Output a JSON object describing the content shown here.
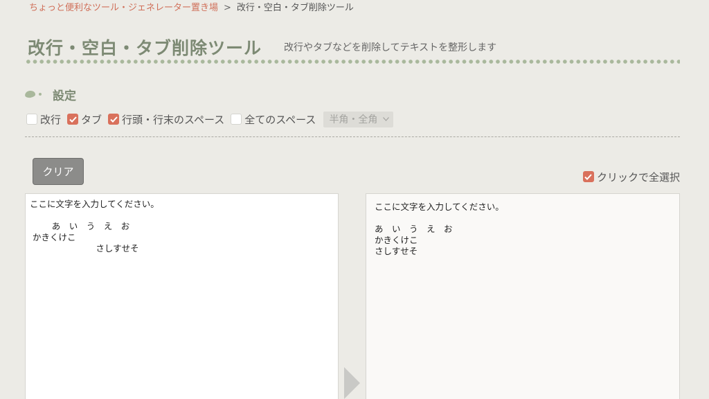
{
  "breadcrumb": {
    "home": "ちょっと便利なツール・ジェネレーター置き場",
    "separator": ">",
    "current": "改行・空白・タブ削除ツール"
  },
  "page": {
    "title": "改行・空白・タブ削除ツール",
    "subtitle": "改行やタブなどを削除してテキストを整形します"
  },
  "settings": {
    "heading": "設定",
    "options": [
      {
        "label": "改行",
        "checked": false
      },
      {
        "label": "タブ",
        "checked": true
      },
      {
        "label": "行頭・行末のスペース",
        "checked": true
      },
      {
        "label": "全てのスペース",
        "checked": false
      }
    ],
    "width_select": "半角・全角"
  },
  "actions": {
    "clear_label": "クリア",
    "select_all_label": "クリックで全選択",
    "select_all_checked": true
  },
  "input_text": "ここに文字を入力してください。\n\n\tあ　い　う　え　お\n かきくけこ\n\t\t\tさしすせそ",
  "output_text": "ここに文字を入力してください。\n\nあ　い　う　え　お\nかきくけこ\nさしすせそ",
  "colors": {
    "accent": "#d9715c",
    "title_green": "#7d8a74",
    "background": "#ecebe6"
  }
}
